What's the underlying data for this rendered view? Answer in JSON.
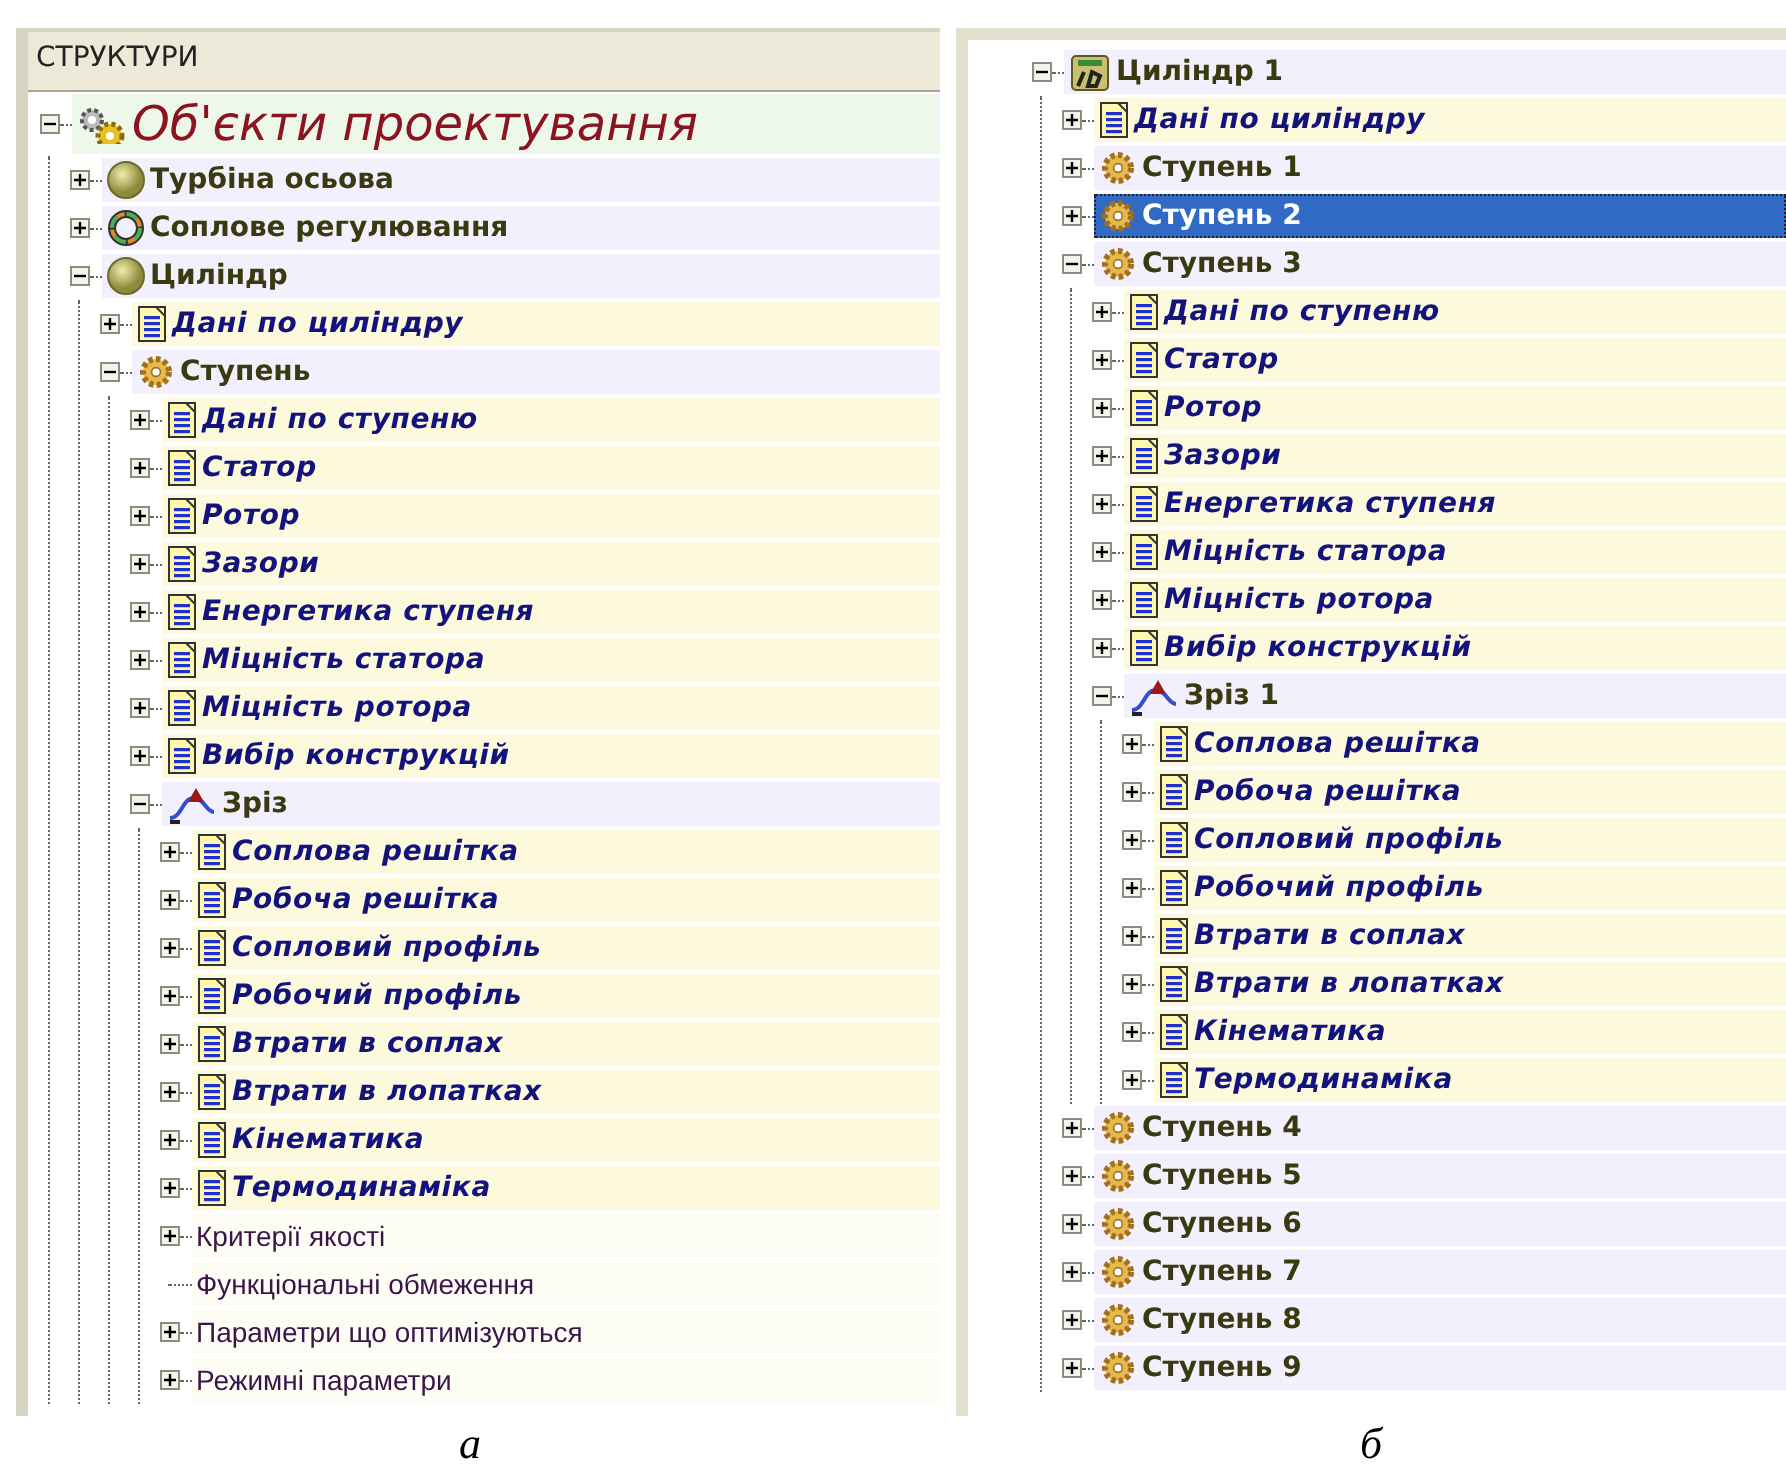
{
  "panels": [
    {
      "header": "СТРУКТУРИ",
      "caption": "а",
      "tree": [
        {
          "kind": "root",
          "label": "Об'єкти проектування",
          "expanded": true,
          "selected": false,
          "children": [
            {
              "kind": "unit",
              "label": "Турбіна осьова",
              "expanded": false,
              "selected": false
            },
            {
              "kind": "regulation",
              "label": "Соплове регулювання",
              "expanded": false,
              "selected": false
            },
            {
              "kind": "unit",
              "label": "Циліндр",
              "expanded": true,
              "selected": false,
              "children": [
                {
                  "kind": "data",
                  "label": "Дані по циліндру",
                  "expanded": false,
                  "selected": false
                },
                {
                  "kind": "stage",
                  "label": "Ступень",
                  "expanded": true,
                  "selected": false,
                  "children": [
                    {
                      "kind": "data",
                      "label": "Дані по ступеню",
                      "expanded": false,
                      "selected": false
                    },
                    {
                      "kind": "data",
                      "label": "Статор",
                      "expanded": false,
                      "selected": false
                    },
                    {
                      "kind": "data",
                      "label": "Ротор",
                      "expanded": false,
                      "selected": false
                    },
                    {
                      "kind": "data",
                      "label": "Зазори",
                      "expanded": false,
                      "selected": false
                    },
                    {
                      "kind": "data",
                      "label": "Енергетика ступеня",
                      "expanded": false,
                      "selected": false
                    },
                    {
                      "kind": "data",
                      "label": "Міцність статора",
                      "expanded": false,
                      "selected": false
                    },
                    {
                      "kind": "data",
                      "label": "Міцність ротора",
                      "expanded": false,
                      "selected": false
                    },
                    {
                      "kind": "data",
                      "label": "Вибір конструкцій",
                      "expanded": false,
                      "selected": false
                    },
                    {
                      "kind": "section",
                      "label": "Зріз",
                      "expanded": true,
                      "selected": false,
                      "children": [
                        {
                          "kind": "data",
                          "label": "Соплова решітка",
                          "expanded": false,
                          "selected": false
                        },
                        {
                          "kind": "data",
                          "label": "Робоча решітка",
                          "expanded": false,
                          "selected": false
                        },
                        {
                          "kind": "data",
                          "label": "Сопловий профіль",
                          "expanded": false,
                          "selected": false
                        },
                        {
                          "kind": "data",
                          "label": "Робочий профіль",
                          "expanded": false,
                          "selected": false
                        },
                        {
                          "kind": "data",
                          "label": "Втрати в соплах",
                          "expanded": false,
                          "selected": false
                        },
                        {
                          "kind": "data",
                          "label": "Втрати в лопатках",
                          "expanded": false,
                          "selected": false
                        },
                        {
                          "kind": "data",
                          "label": "Кінематика",
                          "expanded": false,
                          "selected": false
                        },
                        {
                          "kind": "data",
                          "label": "Термодинаміка",
                          "expanded": false,
                          "selected": false
                        },
                        {
                          "kind": "param",
                          "label": "Критерії якості",
                          "expanded": false,
                          "selected": false
                        },
                        {
                          "kind": "param",
                          "label": "Функціональні обмеження",
                          "selected": false
                        },
                        {
                          "kind": "param",
                          "label": "Параметри що оптимізуються",
                          "expanded": false,
                          "selected": false
                        },
                        {
                          "kind": "param",
                          "label": "Режимні параметри",
                          "expanded": false,
                          "selected": false
                        }
                      ]
                    }
                  ]
                }
              ]
            }
          ]
        }
      ]
    },
    {
      "caption": "б",
      "tree": [
        {
          "kind": "cylinder",
          "label": "Циліндр 1",
          "expanded": true,
          "selected": false,
          "children": [
            {
              "kind": "data",
              "label": "Дані по циліндру",
              "expanded": false,
              "selected": false
            },
            {
              "kind": "stage",
              "label": "Ступень 1",
              "expanded": false,
              "selected": false
            },
            {
              "kind": "stage",
              "label": "Ступень 2",
              "expanded": false,
              "selected": true
            },
            {
              "kind": "stage",
              "label": "Ступень 3",
              "expanded": true,
              "selected": false,
              "children": [
                {
                  "kind": "data",
                  "label": "Дані по ступеню",
                  "expanded": false,
                  "selected": false
                },
                {
                  "kind": "data",
                  "label": "Статор",
                  "expanded": false,
                  "selected": false
                },
                {
                  "kind": "data",
                  "label": "Ротор",
                  "expanded": false,
                  "selected": false
                },
                {
                  "kind": "data",
                  "label": "Зазори",
                  "expanded": false,
                  "selected": false
                },
                {
                  "kind": "data",
                  "label": "Енергетика ступеня",
                  "expanded": false,
                  "selected": false
                },
                {
                  "kind": "data",
                  "label": "Міцність статора",
                  "expanded": false,
                  "selected": false
                },
                {
                  "kind": "data",
                  "label": "Міцність ротора",
                  "expanded": false,
                  "selected": false
                },
                {
                  "kind": "data",
                  "label": "Вибір конструкцій",
                  "expanded": false,
                  "selected": false
                },
                {
                  "kind": "section",
                  "label": "Зріз 1",
                  "expanded": true,
                  "selected": false,
                  "children": [
                    {
                      "kind": "data",
                      "label": "Соплова решітка",
                      "expanded": false,
                      "selected": false
                    },
                    {
                      "kind": "data",
                      "label": "Робоча решітка",
                      "expanded": false,
                      "selected": false
                    },
                    {
                      "kind": "data",
                      "label": "Сопловий профіль",
                      "expanded": false,
                      "selected": false
                    },
                    {
                      "kind": "data",
                      "label": "Робочий профіль",
                      "expanded": false,
                      "selected": false
                    },
                    {
                      "kind": "data",
                      "label": "Втрати в соплах",
                      "expanded": false,
                      "selected": false
                    },
                    {
                      "kind": "data",
                      "label": "Втрати в лопатках",
                      "expanded": false,
                      "selected": false
                    },
                    {
                      "kind": "data",
                      "label": "Кінематика",
                      "expanded": false,
                      "selected": false
                    },
                    {
                      "kind": "data",
                      "label": "Термодинаміка",
                      "expanded": false,
                      "selected": false
                    }
                  ]
                }
              ]
            },
            {
              "kind": "stage",
              "label": "Ступень 4",
              "expanded": false,
              "selected": false
            },
            {
              "kind": "stage",
              "label": "Ступень 5",
              "expanded": false,
              "selected": false
            },
            {
              "kind": "stage",
              "label": "Ступень 6",
              "expanded": false,
              "selected": false
            },
            {
              "kind": "stage",
              "label": "Ступень 7",
              "expanded": false,
              "selected": false
            },
            {
              "kind": "stage",
              "label": "Ступень 8",
              "expanded": false,
              "selected": false
            },
            {
              "kind": "stage",
              "label": "Ступень 9",
              "expanded": false,
              "selected": false
            }
          ]
        }
      ]
    }
  ]
}
